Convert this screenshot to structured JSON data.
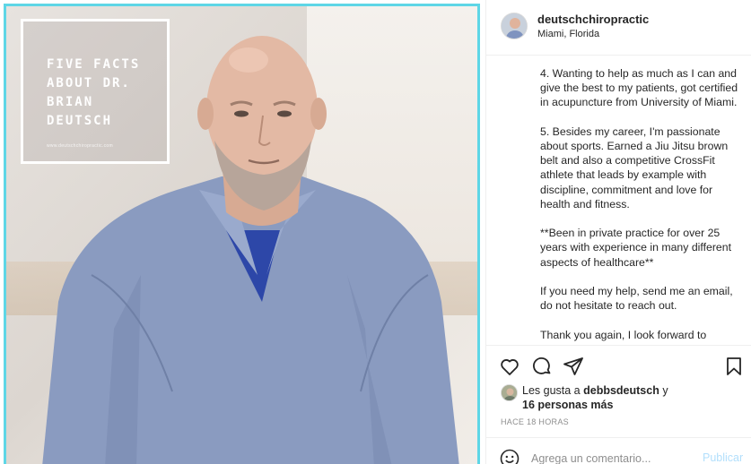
{
  "post_image": {
    "headline_lines": [
      "FIVE FACTS",
      "ABOUT DR.",
      "BRIAN",
      "DEUTSCH"
    ],
    "website": "www.deutschchiropractic.com"
  },
  "header": {
    "username": "deutschchiropractic",
    "location": "Miami, Florida"
  },
  "caption": {
    "paragraphs": [
      "4. Wanting to help as much as I can and give the best to my patients, got certified in acupuncture from University of Miami.",
      "5. Besides my career, I'm passionate about sports. Earned a Jiu Jitsu brown belt and also a competitive CrossFit athlete that leads by example with discipline, commitment and love for health and fitness.",
      "**Been in private practice for over 25 years with experience in many different aspects of healthcare**",
      "If you need my help, send me an email, do not hesitate to reach out.",
      "Thank you again, I look forward to"
    ]
  },
  "actions": {
    "like_icon": "heart-icon",
    "comment_icon": "comment-bubble-icon",
    "share_icon": "paper-plane-icon",
    "save_icon": "bookmark-icon"
  },
  "likes": {
    "prefix": "Les gusta a ",
    "liker": "debbsdeutsch",
    "connector": " y",
    "others": "16 personas más"
  },
  "timestamp": "HACE 18 HORAS",
  "comment": {
    "emoji_icon": "smiley-icon",
    "placeholder": "Agrega un comentario...",
    "post_label": "Publicar"
  },
  "colors": {
    "frame_border": "#5ed6e6",
    "post_button": "#b2dffc",
    "muted_text": "#8e8e8e"
  }
}
